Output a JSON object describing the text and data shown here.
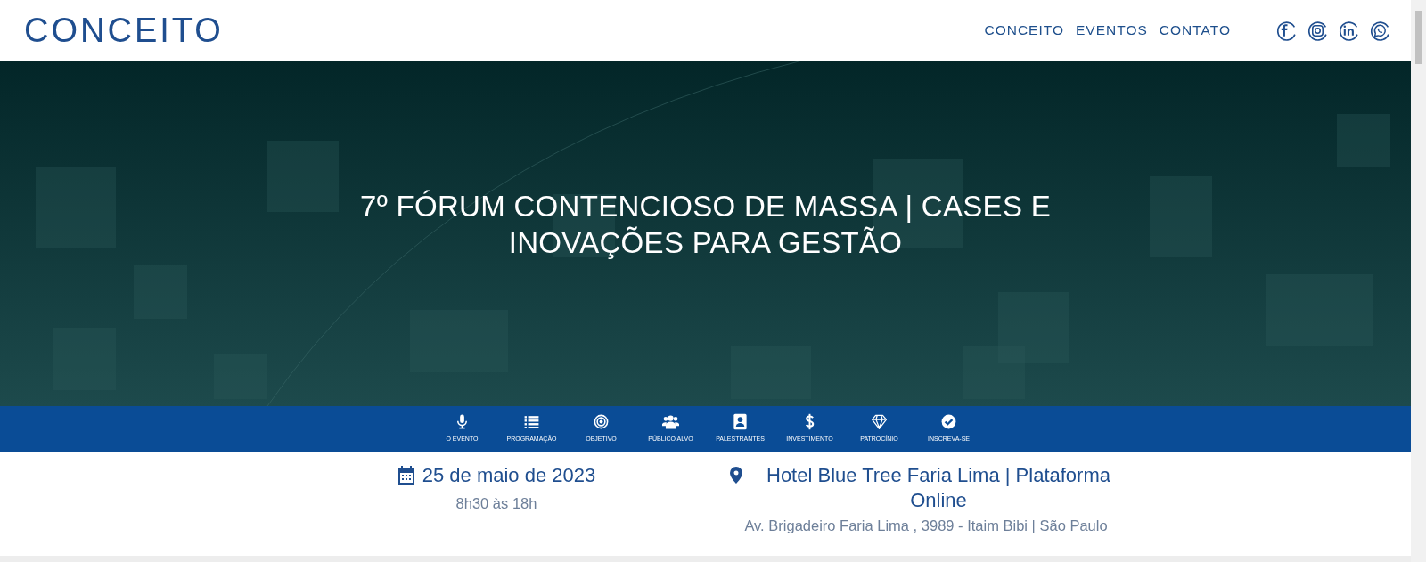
{
  "header": {
    "logo": "CONCEITO",
    "nav": [
      {
        "label": "CONCEITO"
      },
      {
        "label": "EVENTOS"
      },
      {
        "label": "CONTATO"
      }
    ],
    "social": [
      {
        "kind": "facebook"
      },
      {
        "kind": "instagram"
      },
      {
        "kind": "linkedin"
      },
      {
        "kind": "whatsapp"
      }
    ]
  },
  "hero": {
    "title": "7º FÓRUM CONTENCIOSO DE MASSA | CASES E INOVAÇÕES PARA GESTÃO"
  },
  "section_nav": [
    {
      "label": "O EVENTO",
      "kind": "microphone"
    },
    {
      "label": "PROGRAMAÇÃO",
      "kind": "list"
    },
    {
      "label": "OBJETIVO",
      "kind": "target"
    },
    {
      "label": "PÚBLICO ALVO",
      "kind": "users"
    },
    {
      "label": "PALESTRANTES",
      "kind": "contacts"
    },
    {
      "label": "INVESTIMENTO",
      "kind": "dollar"
    },
    {
      "label": "PATROCÍNIO",
      "kind": "diamond"
    },
    {
      "label": "INSCREVA-SE",
      "kind": "check"
    }
  ],
  "event_info": {
    "date": "25 de maio de 2023",
    "time": "8h30 às 18h",
    "venue": "Hotel Blue Tree Faria Lima | Plataforma Online",
    "address": "Av. Brigadeiro Faria Lima , 3989 - Itaim Bibi | São Paulo"
  }
}
